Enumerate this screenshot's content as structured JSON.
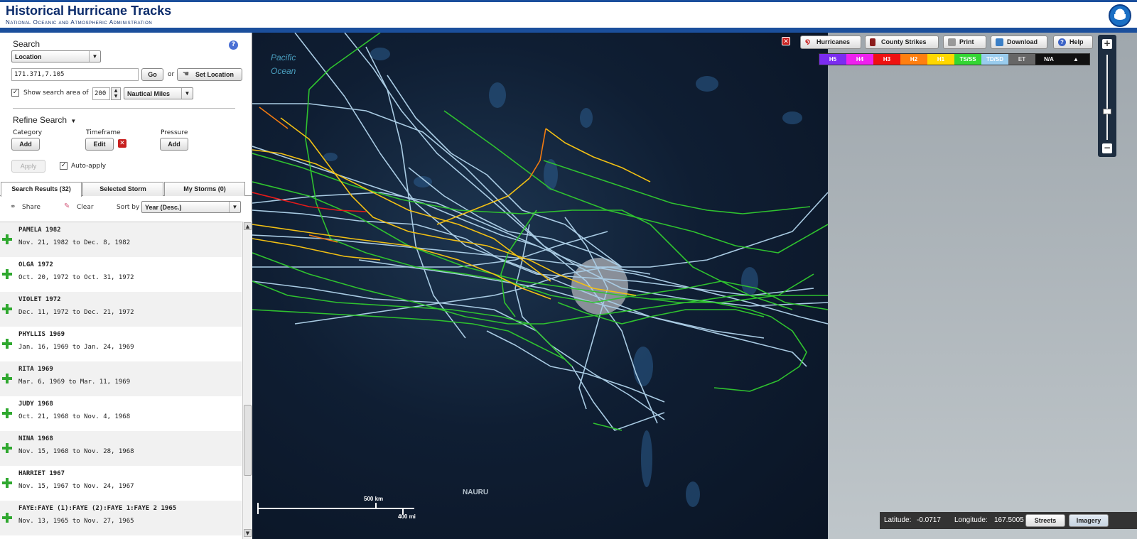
{
  "header": {
    "title": "Historical Hurricane Tracks",
    "subtitle": "National Oceanic and Atmospheric Administration"
  },
  "search": {
    "heading": "Search",
    "type_value": "Location",
    "location_value": "171.371,7.105",
    "go_label": "Go",
    "or_label": "or",
    "set_location_label": "Set Location",
    "show_area_label": "Show search area of",
    "show_area_checked": true,
    "radius_value": "200",
    "unit_value": "Nautical Miles"
  },
  "refine": {
    "heading": "Refine Search",
    "category_label": "Category",
    "category_button": "Add",
    "timeframe_label": "Timeframe",
    "timeframe_button": "Edit",
    "pressure_label": "Pressure",
    "pressure_button": "Add",
    "apply_label": "Apply",
    "auto_apply_label": "Auto-apply",
    "auto_apply_checked": true
  },
  "tabs": [
    {
      "label": "Search Results (32)",
      "active": true
    },
    {
      "label": "Selected Storm",
      "active": false
    },
    {
      "label": "My Storms (0)",
      "active": false
    }
  ],
  "results_toolbar": {
    "share_label": "Share",
    "clear_label": "Clear",
    "sort_label": "Sort by",
    "sort_value": "Year (Desc.)"
  },
  "results": [
    {
      "name": "PAMELA 1982",
      "dates": "Nov. 21, 1982 to Dec. 8, 1982"
    },
    {
      "name": "OLGA 1972",
      "dates": "Oct. 20, 1972 to Oct. 31, 1972"
    },
    {
      "name": "VIOLET 1972",
      "dates": "Dec. 11, 1972 to Dec. 21, 1972"
    },
    {
      "name": "PHYLLIS 1969",
      "dates": "Jan. 16, 1969 to Jan. 24, 1969"
    },
    {
      "name": "RITA 1969",
      "dates": "Mar. 6, 1969 to Mar. 11, 1969"
    },
    {
      "name": "JUDY 1968",
      "dates": "Oct. 21, 1968 to Nov. 4, 1968"
    },
    {
      "name": "NINA 1968",
      "dates": "Nov. 15, 1968 to Nov. 28, 1968"
    },
    {
      "name": "HARRIET 1967",
      "dates": "Nov. 15, 1967 to Nov. 24, 1967"
    },
    {
      "name": "FAYE:FAYE (1):FAYE (2):FAYE 1:FAYE 2 1965",
      "dates": "Nov. 13, 1965 to Nov. 27, 1965"
    }
  ],
  "map_toolbar": {
    "hurricanes_label": "Hurricanes",
    "county_strikes_label": "County Strikes",
    "print_label": "Print",
    "download_label": "Download",
    "help_label": "Help"
  },
  "legend": [
    {
      "label": "H5",
      "bg": "#7b2cf0",
      "fg": "#ffffff"
    },
    {
      "label": "H4",
      "bg": "#ee22ee",
      "fg": "#ffffff"
    },
    {
      "label": "H3",
      "bg": "#ee1111",
      "fg": "#ffffff"
    },
    {
      "label": "H2",
      "bg": "#ff7f10",
      "fg": "#ffffff"
    },
    {
      "label": "H1",
      "bg": "#ffd700",
      "fg": "#ffffff"
    },
    {
      "label": "TS/SS",
      "bg": "#33d633",
      "fg": "#ffffff"
    },
    {
      "label": "TD/SD",
      "bg": "#99ccee",
      "fg": "#ffffff"
    },
    {
      "label": "ET",
      "bg": "#666666",
      "fg": "#dddddd"
    },
    {
      "label": "N/A",
      "bg": "#111111",
      "fg": "#ffffff"
    },
    {
      "label": "▲",
      "bg": "#111111",
      "fg": "#ffffff"
    }
  ],
  "map": {
    "ocean_label_line1": "Pacific",
    "ocean_label_line2": "Ocean",
    "place_label": "NAURU",
    "scale_km": "500 km",
    "scale_mi": "400 mi"
  },
  "status": {
    "latitude_label": "Latitude:",
    "latitude_value": "-0.0717",
    "longitude_label": "Longitude:",
    "longitude_value": "167.5005",
    "streets_label": "Streets",
    "imagery_label": "Imagery"
  },
  "colors": {
    "header_blue": "#1b4f9c",
    "track_td": "#a9cbe3",
    "track_ts": "#2fc22f",
    "track_h1": "#f2c014",
    "track_h2": "#f27a10",
    "track_h3": "#e41a1a"
  }
}
